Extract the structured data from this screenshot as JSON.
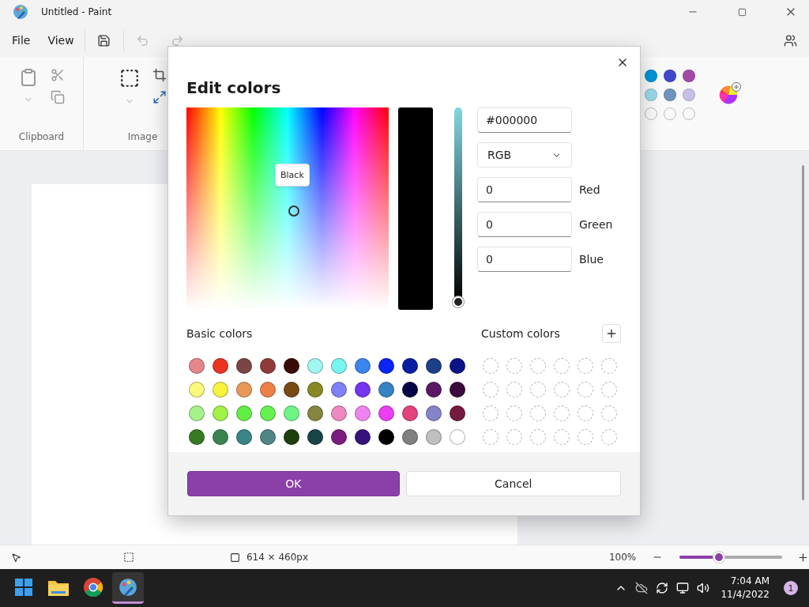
{
  "window": {
    "title": "Untitled - Paint"
  },
  "menu": [
    {
      "label": "File"
    },
    {
      "label": "View"
    }
  ],
  "ribbon": {
    "groups": [
      {
        "label": "Clipboard"
      },
      {
        "label": "Image"
      }
    ],
    "palette": [
      {
        "kind": "filled",
        "color": "#0095d9"
      },
      {
        "kind": "filled",
        "color": "#3f48cc"
      },
      {
        "kind": "filled",
        "color": "#a349a4"
      },
      {
        "kind": "filled",
        "color": "#99d9ea"
      },
      {
        "kind": "filled",
        "color": "#7092be"
      },
      {
        "kind": "filled",
        "color": "#c8bfe7"
      },
      {
        "kind": "empty"
      },
      {
        "kind": "empty"
      },
      {
        "kind": "empty"
      }
    ]
  },
  "dialog": {
    "title": "Edit colors",
    "tooltip": "Black",
    "value_slider": {
      "level": 0
    },
    "hex": "#000000",
    "mode": "RGB",
    "channels": [
      {
        "label": "Red",
        "value": "0"
      },
      {
        "label": "Green",
        "value": "0"
      },
      {
        "label": "Blue",
        "value": "0"
      }
    ],
    "basic_colors": {
      "label": "Basic colors",
      "swatches": [
        {
          "color": "#e7868a"
        },
        {
          "color": "#ec3323"
        },
        {
          "color": "#7c4545"
        },
        {
          "color": "#8f3c3a"
        },
        {
          "color": "#3b0b08"
        },
        {
          "color": "#a0f6f1"
        },
        {
          "color": "#77f5f3"
        },
        {
          "color": "#3a86ee"
        },
        {
          "color": "#0a25f5"
        },
        {
          "color": "#0a1ea3"
        },
        {
          "color": "#1c3f87"
        },
        {
          "color": "#0a1486"
        },
        {
          "color": "#fbf87b"
        },
        {
          "color": "#f8f43d"
        },
        {
          "color": "#e8995a"
        },
        {
          "color": "#ed8047"
        },
        {
          "color": "#7a4a15"
        },
        {
          "color": "#878a24"
        },
        {
          "color": "#8081f6"
        },
        {
          "color": "#7635f0"
        },
        {
          "color": "#3683c3"
        },
        {
          "color": "#070546"
        },
        {
          "color": "#5a1866"
        },
        {
          "color": "#3a0b3c"
        },
        {
          "color": "#a5f28a"
        },
        {
          "color": "#a2f248"
        },
        {
          "color": "#63ee45"
        },
        {
          "color": "#65f24f"
        },
        {
          "color": "#6ef586"
        },
        {
          "color": "#84853f"
        },
        {
          "color": "#ef89bf"
        },
        {
          "color": "#ee85ee"
        },
        {
          "color": "#ea3ff5"
        },
        {
          "color": "#e3427c"
        },
        {
          "color": "#8584c8"
        },
        {
          "color": "#761940"
        },
        {
          "color": "#367b23"
        },
        {
          "color": "#3a8450"
        },
        {
          "color": "#3a8585"
        },
        {
          "color": "#508585"
        },
        {
          "color": "#1d3e0d"
        },
        {
          "color": "#174444"
        },
        {
          "color": "#7a1d7f"
        },
        {
          "color": "#36127b"
        },
        {
          "color": "#000000"
        },
        {
          "color": "#808080"
        },
        {
          "color": "#c0c0c0"
        },
        {
          "color": "#ffffff"
        }
      ]
    },
    "custom_colors": {
      "label": "Custom colors"
    },
    "buttons": [
      {
        "label": "OK",
        "kind": "primary"
      },
      {
        "label": "Cancel",
        "kind": "secondary"
      }
    ]
  },
  "status_bar": {
    "canvas_size": "614 × 460px",
    "zoom": "100%",
    "zoom_slider": {
      "level": 0.38
    }
  },
  "taskbar": {
    "apps": [
      {
        "kind": "start",
        "selected": false
      },
      {
        "kind": "explorer",
        "selected": false
      },
      {
        "kind": "browser",
        "selected": false
      },
      {
        "kind": "paint",
        "selected": true
      }
    ],
    "time": "7:04 AM",
    "date": "11/4/2022",
    "notifications": "1"
  }
}
